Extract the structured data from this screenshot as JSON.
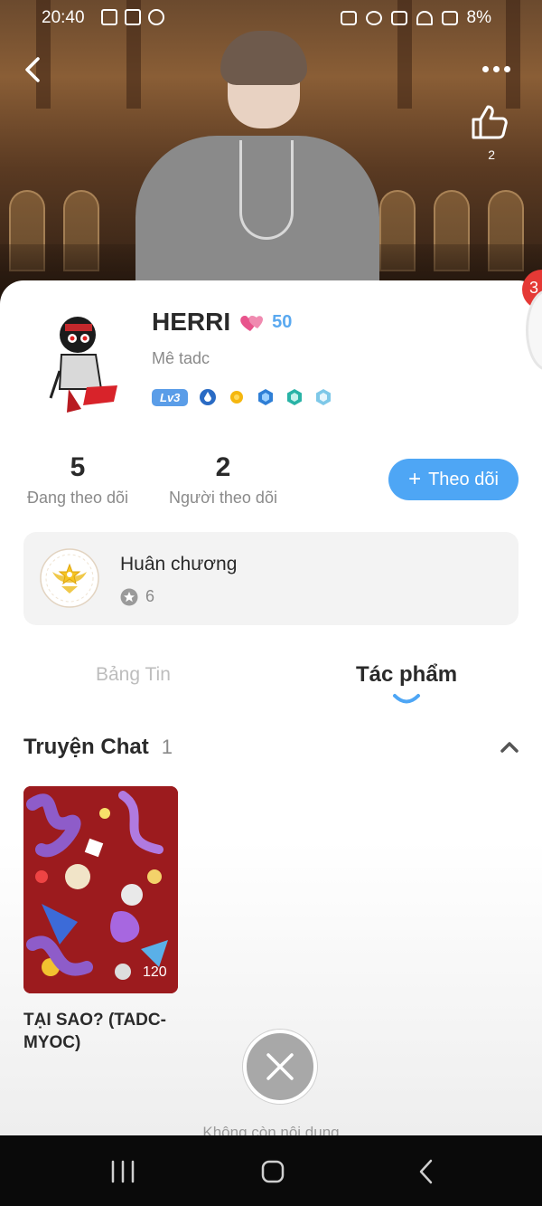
{
  "status_bar": {
    "time": "20:40",
    "battery": "8%"
  },
  "header": {
    "like_count": "2"
  },
  "profile": {
    "name": "HERRI",
    "hearts": "50",
    "bio": "Mê tadc",
    "level": "Lv3"
  },
  "stats": {
    "following_count": "5",
    "following_label": "Đang theo dõi",
    "followers_count": "2",
    "followers_label": "Người theo dõi"
  },
  "follow_button": {
    "plus": "+",
    "label": "Theo dõi"
  },
  "medals": {
    "title": "Huân chương",
    "count": "6"
  },
  "tabs": [
    {
      "label": "Bảng Tin",
      "active": false
    },
    {
      "label": "Tác phẩm",
      "active": true
    }
  ],
  "section": {
    "title": "Truyện Chat",
    "count": "1"
  },
  "stories": [
    {
      "title": "TẠI SAO? (TADC-MYOC)",
      "views": "120"
    }
  ],
  "notification_count": "3",
  "footer_text": "Không còn nội dung",
  "colors": {
    "accent": "#4ea6f5",
    "heart": "#e8548c",
    "story_bg": "#9c1b1e"
  }
}
